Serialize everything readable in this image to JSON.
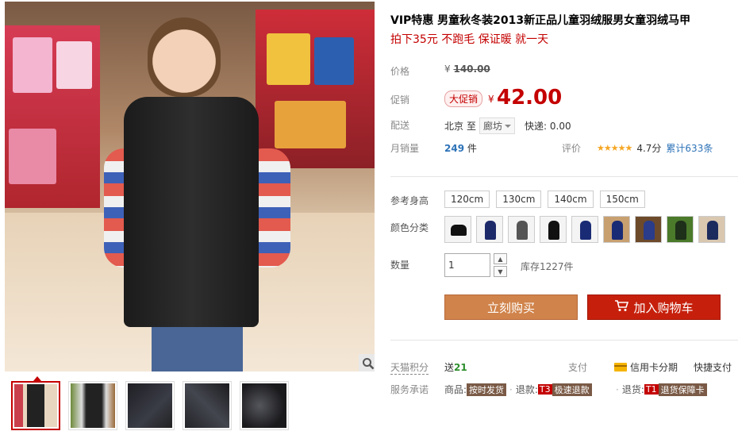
{
  "product": {
    "title": "VIP特惠 男童秋冬装2013新正品儿童羽绒服男女童羽绒马甲",
    "subtitle": "拍下35元 不跑毛 保证暖 就一天"
  },
  "price": {
    "label": "价格",
    "currency": "¥",
    "original": "140.00"
  },
  "promotion": {
    "label": "促销",
    "tag": "大促销",
    "currency": "¥",
    "price": "42.00"
  },
  "shipping": {
    "label": "配送",
    "from": "北京",
    "to_word": "至",
    "destination": "廊坊",
    "express": "快递: 0.00"
  },
  "sales": {
    "label": "月销量",
    "count": "249",
    "unit": "件"
  },
  "rating": {
    "label": "评价",
    "stars": "★★★★★",
    "score": "4.7分",
    "reviews": "累计633条"
  },
  "size": {
    "label": "参考身高",
    "options": [
      "120cm",
      "130cm",
      "140cm",
      "150cm"
    ]
  },
  "color": {
    "label": "颜色分类"
  },
  "quantity": {
    "label": "数量",
    "value": "1",
    "up": "▲",
    "down": "▼",
    "stock": "库存1227件"
  },
  "actions": {
    "buy": "立刻购买",
    "cart": "加入购物车"
  },
  "points": {
    "label": "天猫积分",
    "give": "送",
    "value": "21"
  },
  "payment": {
    "label": "支付",
    "credit": "信用卡分期",
    "quick": "快捷支付"
  },
  "promise": {
    "label": "服务承诺",
    "goods_k": "商品:",
    "goods_v": "按时发货",
    "refund_k": "退款:",
    "refund_t": "T3",
    "refund_v": "极速退款",
    "return_k": "退货:",
    "return_t": "T1",
    "return_v": "退货保障卡"
  },
  "colors": {
    "accent": "#c40000",
    "buy_button": "#d0834a",
    "cart_button": "#c6200c",
    "link": "#2e73b8"
  }
}
